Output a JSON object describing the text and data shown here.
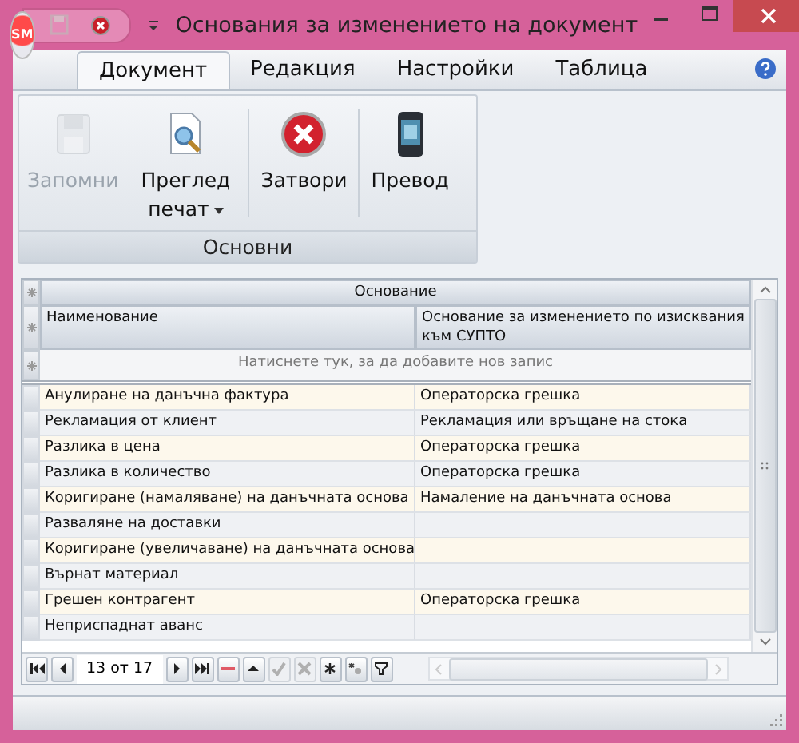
{
  "window": {
    "title": "Основания за изменението на документ",
    "logo_text": "SM"
  },
  "tabs": [
    {
      "label": "Документ",
      "selected": true
    },
    {
      "label": "Редакция",
      "selected": false
    },
    {
      "label": "Настройки",
      "selected": false
    },
    {
      "label": "Таблица",
      "selected": false
    }
  ],
  "ribbon": {
    "group": "Основни",
    "buttons": [
      {
        "kind": "save",
        "label": "Запомни",
        "disabled": true,
        "dropdown": false
      },
      {
        "kind": "preview",
        "label": "Преглед печат",
        "disabled": false,
        "dropdown": true
      },
      {
        "kind": "close",
        "label": "Затвори",
        "disabled": false,
        "dropdown": false
      },
      {
        "kind": "translate",
        "label": "Превод",
        "disabled": false,
        "dropdown": false
      }
    ]
  },
  "table": {
    "band": "Основание",
    "columns": [
      "Наименование",
      "Основание за изменението по изисквания към СУПТО"
    ],
    "new_row": "Натиснете тук, за да добавите нов запис",
    "rows": [
      [
        "Анулиране на данъчна фактура",
        "Операторска грешка"
      ],
      [
        "Рекламация от клиент",
        "Рекламация или връщане на стока"
      ],
      [
        "Разлика в цена",
        "Операторска грешка"
      ],
      [
        "Разлика в количество",
        "Операторска грешка"
      ],
      [
        "Коригиране (намаляване) на данъчната основа",
        "Намаление на данъчната основа"
      ],
      [
        "Разваляне на доставки",
        ""
      ],
      [
        "Коригиране (увеличаване) на данъчната основа",
        ""
      ],
      [
        "Върнат материал",
        ""
      ],
      [
        "Грешен контрагент",
        "Операторска грешка"
      ],
      [
        "Неприспаднат аванс",
        ""
      ]
    ]
  },
  "navigator": {
    "position": "13 от 17",
    "buttons": [
      {
        "kind": "first",
        "disabled": false
      },
      {
        "kind": "prev",
        "disabled": false
      },
      {
        "kind": "pos"
      },
      {
        "kind": "next",
        "disabled": false
      },
      {
        "kind": "last",
        "disabled": false
      },
      {
        "kind": "delete",
        "disabled": false
      },
      {
        "kind": "up",
        "disabled": false
      },
      {
        "kind": "confirm",
        "disabled": true
      },
      {
        "kind": "cancel",
        "disabled": true
      },
      {
        "kind": "star",
        "disabled": false
      },
      {
        "kind": "star2",
        "disabled": false
      },
      {
        "kind": "filter",
        "disabled": false
      }
    ]
  }
}
